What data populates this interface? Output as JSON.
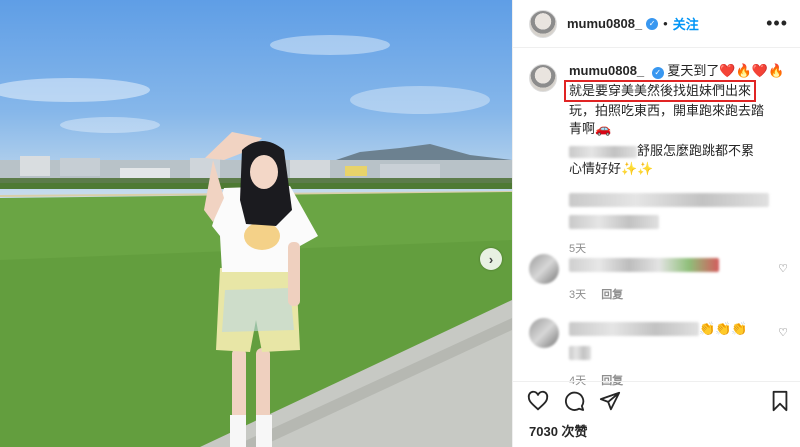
{
  "post": {
    "username": "mumu0808_",
    "follow_label": "关注",
    "caption_user": "mumu0808_",
    "caption_line1": "夏天到了❤️🔥❤️🔥",
    "caption_highlight": "就是要穿美美然後找姐妹們出來",
    "caption_line3": "玩，拍照吃東西，開車跑來跑去踏",
    "caption_line4": "青啊🚗",
    "caption_line5_visible": "舒服怎麼跑跳都不累",
    "caption_line6": "心情好好✨✨",
    "caption_time": "5天",
    "likes_text": "7030 次赞",
    "highlight_color": "#e02424"
  },
  "comments": [
    {
      "time": "3天",
      "reply_label": "回复"
    },
    {
      "emoji_tail": "👏👏👏",
      "time": "4天",
      "reply_label": "回复"
    }
  ],
  "icons": [
    "verified-badge-icon",
    "more-options-icon",
    "heart-icon",
    "comment-icon",
    "share-icon",
    "bookmark-icon",
    "next-arrow-icon"
  ]
}
